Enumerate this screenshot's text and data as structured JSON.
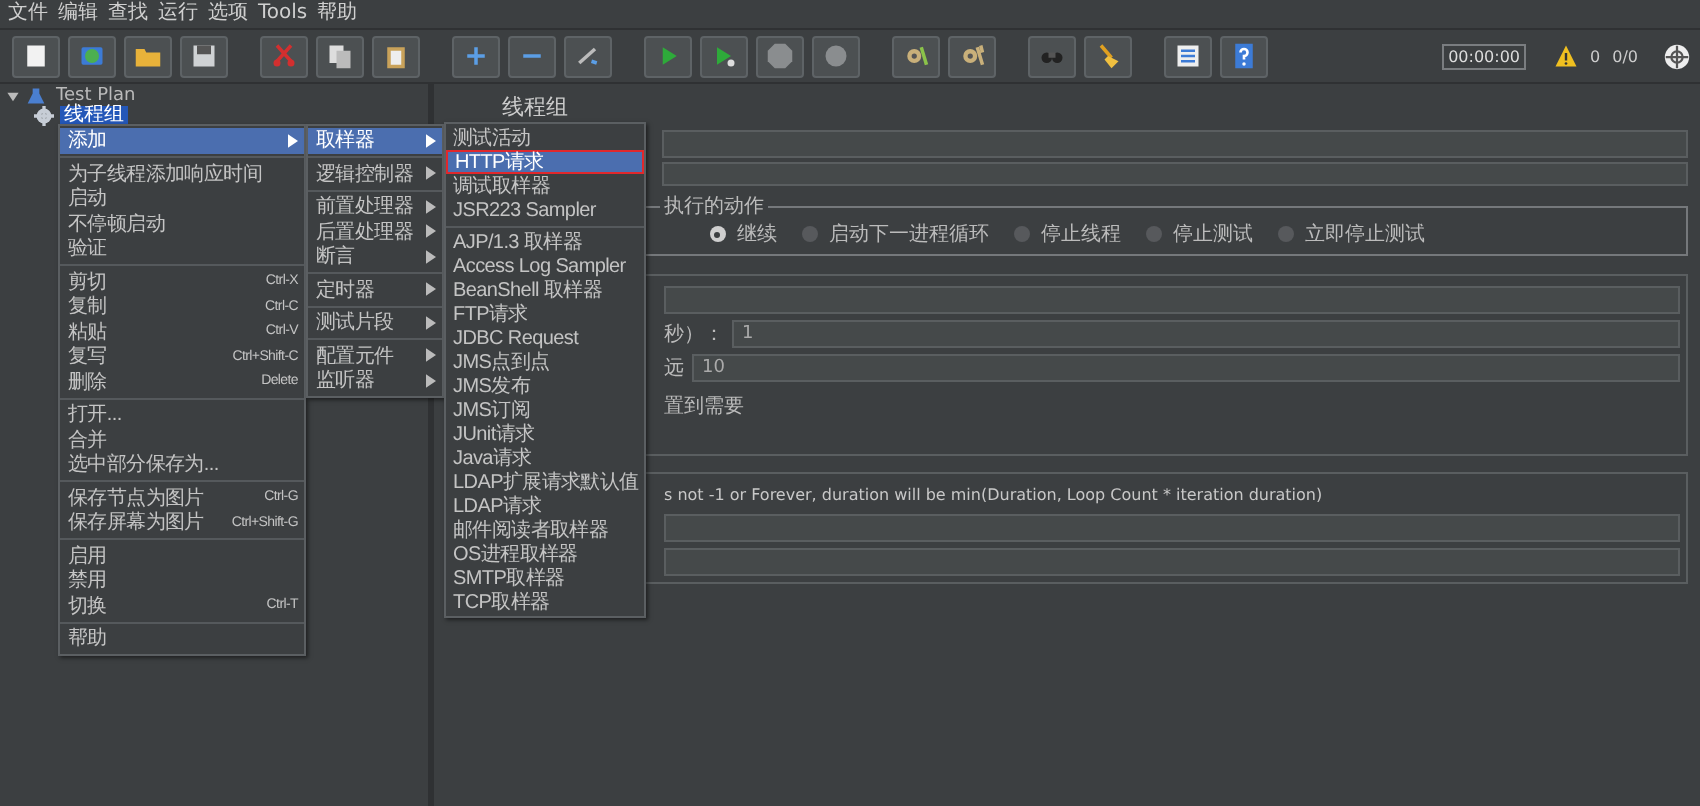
{
  "menubar": [
    "文件",
    "编辑",
    "查找",
    "运行",
    "选项",
    "Tools",
    "帮助"
  ],
  "toolbar_status": {
    "timer": "00:00:00",
    "warnings": "0",
    "threads": "0/0"
  },
  "tree": [
    {
      "label": "Test Plan",
      "expanded": true,
      "selected": false,
      "children": [
        {
          "label": "线程组",
          "selected": true
        }
      ]
    }
  ],
  "context_menu": [
    {
      "kind": "submenu",
      "label": "添加",
      "selected": true
    },
    {
      "kind": "separator"
    },
    {
      "kind": "item",
      "label": "为子线程添加响应时间",
      "selected": false
    },
    {
      "kind": "item",
      "label": "启动",
      "selected": false
    },
    {
      "kind": "item",
      "label": "不停顿启动",
      "selected": false
    },
    {
      "kind": "item",
      "label": "验证",
      "selected": false
    },
    {
      "kind": "separator"
    },
    {
      "kind": "item",
      "label": "剪切",
      "shortcut": "Ctrl-X",
      "selected": false
    },
    {
      "kind": "item",
      "label": "复制",
      "shortcut": "Ctrl-C",
      "selected": false
    },
    {
      "kind": "item",
      "label": "粘贴",
      "shortcut": "Ctrl-V",
      "selected": false
    },
    {
      "kind": "item",
      "label": "复写",
      "shortcut": "Ctrl+Shift-C",
      "selected": false
    },
    {
      "kind": "item",
      "label": "删除",
      "shortcut": "Delete",
      "selected": false
    },
    {
      "kind": "separator"
    },
    {
      "kind": "item",
      "label": "打开...",
      "selected": false
    },
    {
      "kind": "item",
      "label": "合并",
      "selected": false
    },
    {
      "kind": "item",
      "label": "选中部分保存为...",
      "selected": false
    },
    {
      "kind": "separator"
    },
    {
      "kind": "item",
      "label": "保存节点为图片",
      "shortcut": "Ctrl-G",
      "selected": false
    },
    {
      "kind": "item",
      "label": "保存屏幕为图片",
      "shortcut": "Ctrl+Shift-G",
      "selected": false
    },
    {
      "kind": "separator"
    },
    {
      "kind": "item",
      "label": "启用",
      "selected": false
    },
    {
      "kind": "item",
      "label": "禁用",
      "selected": false
    },
    {
      "kind": "item",
      "label": "切换",
      "shortcut": "Ctrl-T",
      "selected": false
    },
    {
      "kind": "separator"
    },
    {
      "kind": "item",
      "label": "帮助",
      "selected": false
    }
  ],
  "add_submenu": [
    {
      "kind": "submenu",
      "label": "取样器",
      "selected": true
    },
    {
      "kind": "separator"
    },
    {
      "kind": "submenu",
      "label": "逻辑控制器",
      "selected": false
    },
    {
      "kind": "separator"
    },
    {
      "kind": "submenu",
      "label": "前置处理器",
      "selected": false
    },
    {
      "kind": "submenu",
      "label": "后置处理器",
      "selected": false
    },
    {
      "kind": "submenu",
      "label": "断言",
      "selected": false
    },
    {
      "kind": "separator"
    },
    {
      "kind": "submenu",
      "label": "定时器",
      "selected": false
    },
    {
      "kind": "separator"
    },
    {
      "kind": "submenu",
      "label": "测试片段",
      "selected": false
    },
    {
      "kind": "separator"
    },
    {
      "kind": "submenu",
      "label": "配置元件",
      "selected": false
    },
    {
      "kind": "submenu",
      "label": "监听器",
      "selected": false
    }
  ],
  "sampler_submenu": [
    {
      "kind": "item",
      "label": "测试活动",
      "selected": false,
      "boxed": false
    },
    {
      "kind": "item",
      "label": "HTTP请求",
      "selected": true,
      "boxed": true
    },
    {
      "kind": "item",
      "label": "调试取样器",
      "selected": false,
      "boxed": false
    },
    {
      "kind": "item",
      "label": "JSR223 Sampler",
      "selected": false,
      "boxed": false
    },
    {
      "kind": "separator"
    },
    {
      "kind": "item",
      "label": "AJP/1.3 取样器",
      "selected": false,
      "boxed": false
    },
    {
      "kind": "item",
      "label": "Access Log Sampler",
      "selected": false,
      "boxed": false
    },
    {
      "kind": "item",
      "label": "BeanShell 取样器",
      "selected": false,
      "boxed": false
    },
    {
      "kind": "item",
      "label": "FTP请求",
      "selected": false,
      "boxed": false
    },
    {
      "kind": "item",
      "label": "JDBC Request",
      "selected": false,
      "boxed": false
    },
    {
      "kind": "item",
      "label": "JMS点到点",
      "selected": false,
      "boxed": false
    },
    {
      "kind": "item",
      "label": "JMS发布",
      "selected": false,
      "boxed": false
    },
    {
      "kind": "item",
      "label": "JMS订阅",
      "selected": false,
      "boxed": false
    },
    {
      "kind": "item",
      "label": "JUnit请求",
      "selected": false,
      "boxed": false
    },
    {
      "kind": "item",
      "label": "Java请求",
      "selected": false,
      "boxed": false
    },
    {
      "kind": "item",
      "label": "LDAP扩展请求默认值",
      "selected": false,
      "boxed": false
    },
    {
      "kind": "item",
      "label": "LDAP请求",
      "selected": false,
      "boxed": false
    },
    {
      "kind": "item",
      "label": "邮件阅读者取样器",
      "selected": false,
      "boxed": false
    },
    {
      "kind": "item",
      "label": "OS进程取样器",
      "selected": false,
      "boxed": false
    },
    {
      "kind": "item",
      "label": "SMTP取样器",
      "selected": false,
      "boxed": false
    },
    {
      "kind": "item",
      "label": "TCP取样器",
      "selected": false,
      "boxed": false
    }
  ],
  "panel": {
    "title": "线程组",
    "action_group": {
      "label": "执行的动作",
      "options": [
        {
          "label": "继续",
          "selected": true
        },
        {
          "label": "启动下一进程循环",
          "selected": false
        },
        {
          "label": "停止线程",
          "selected": false
        },
        {
          "label": "停止测试",
          "selected": false
        },
        {
          "label": "立即停止测试",
          "selected": false
        }
      ]
    },
    "ramp_up": {
      "label": "秒）：",
      "value": "1"
    },
    "loops": {
      "label": "远",
      "value": "10"
    },
    "delay_option": "置到需要",
    "note": "s not -1 or Forever, duration will be min(Duration, Loop Count * iteration duration)"
  }
}
